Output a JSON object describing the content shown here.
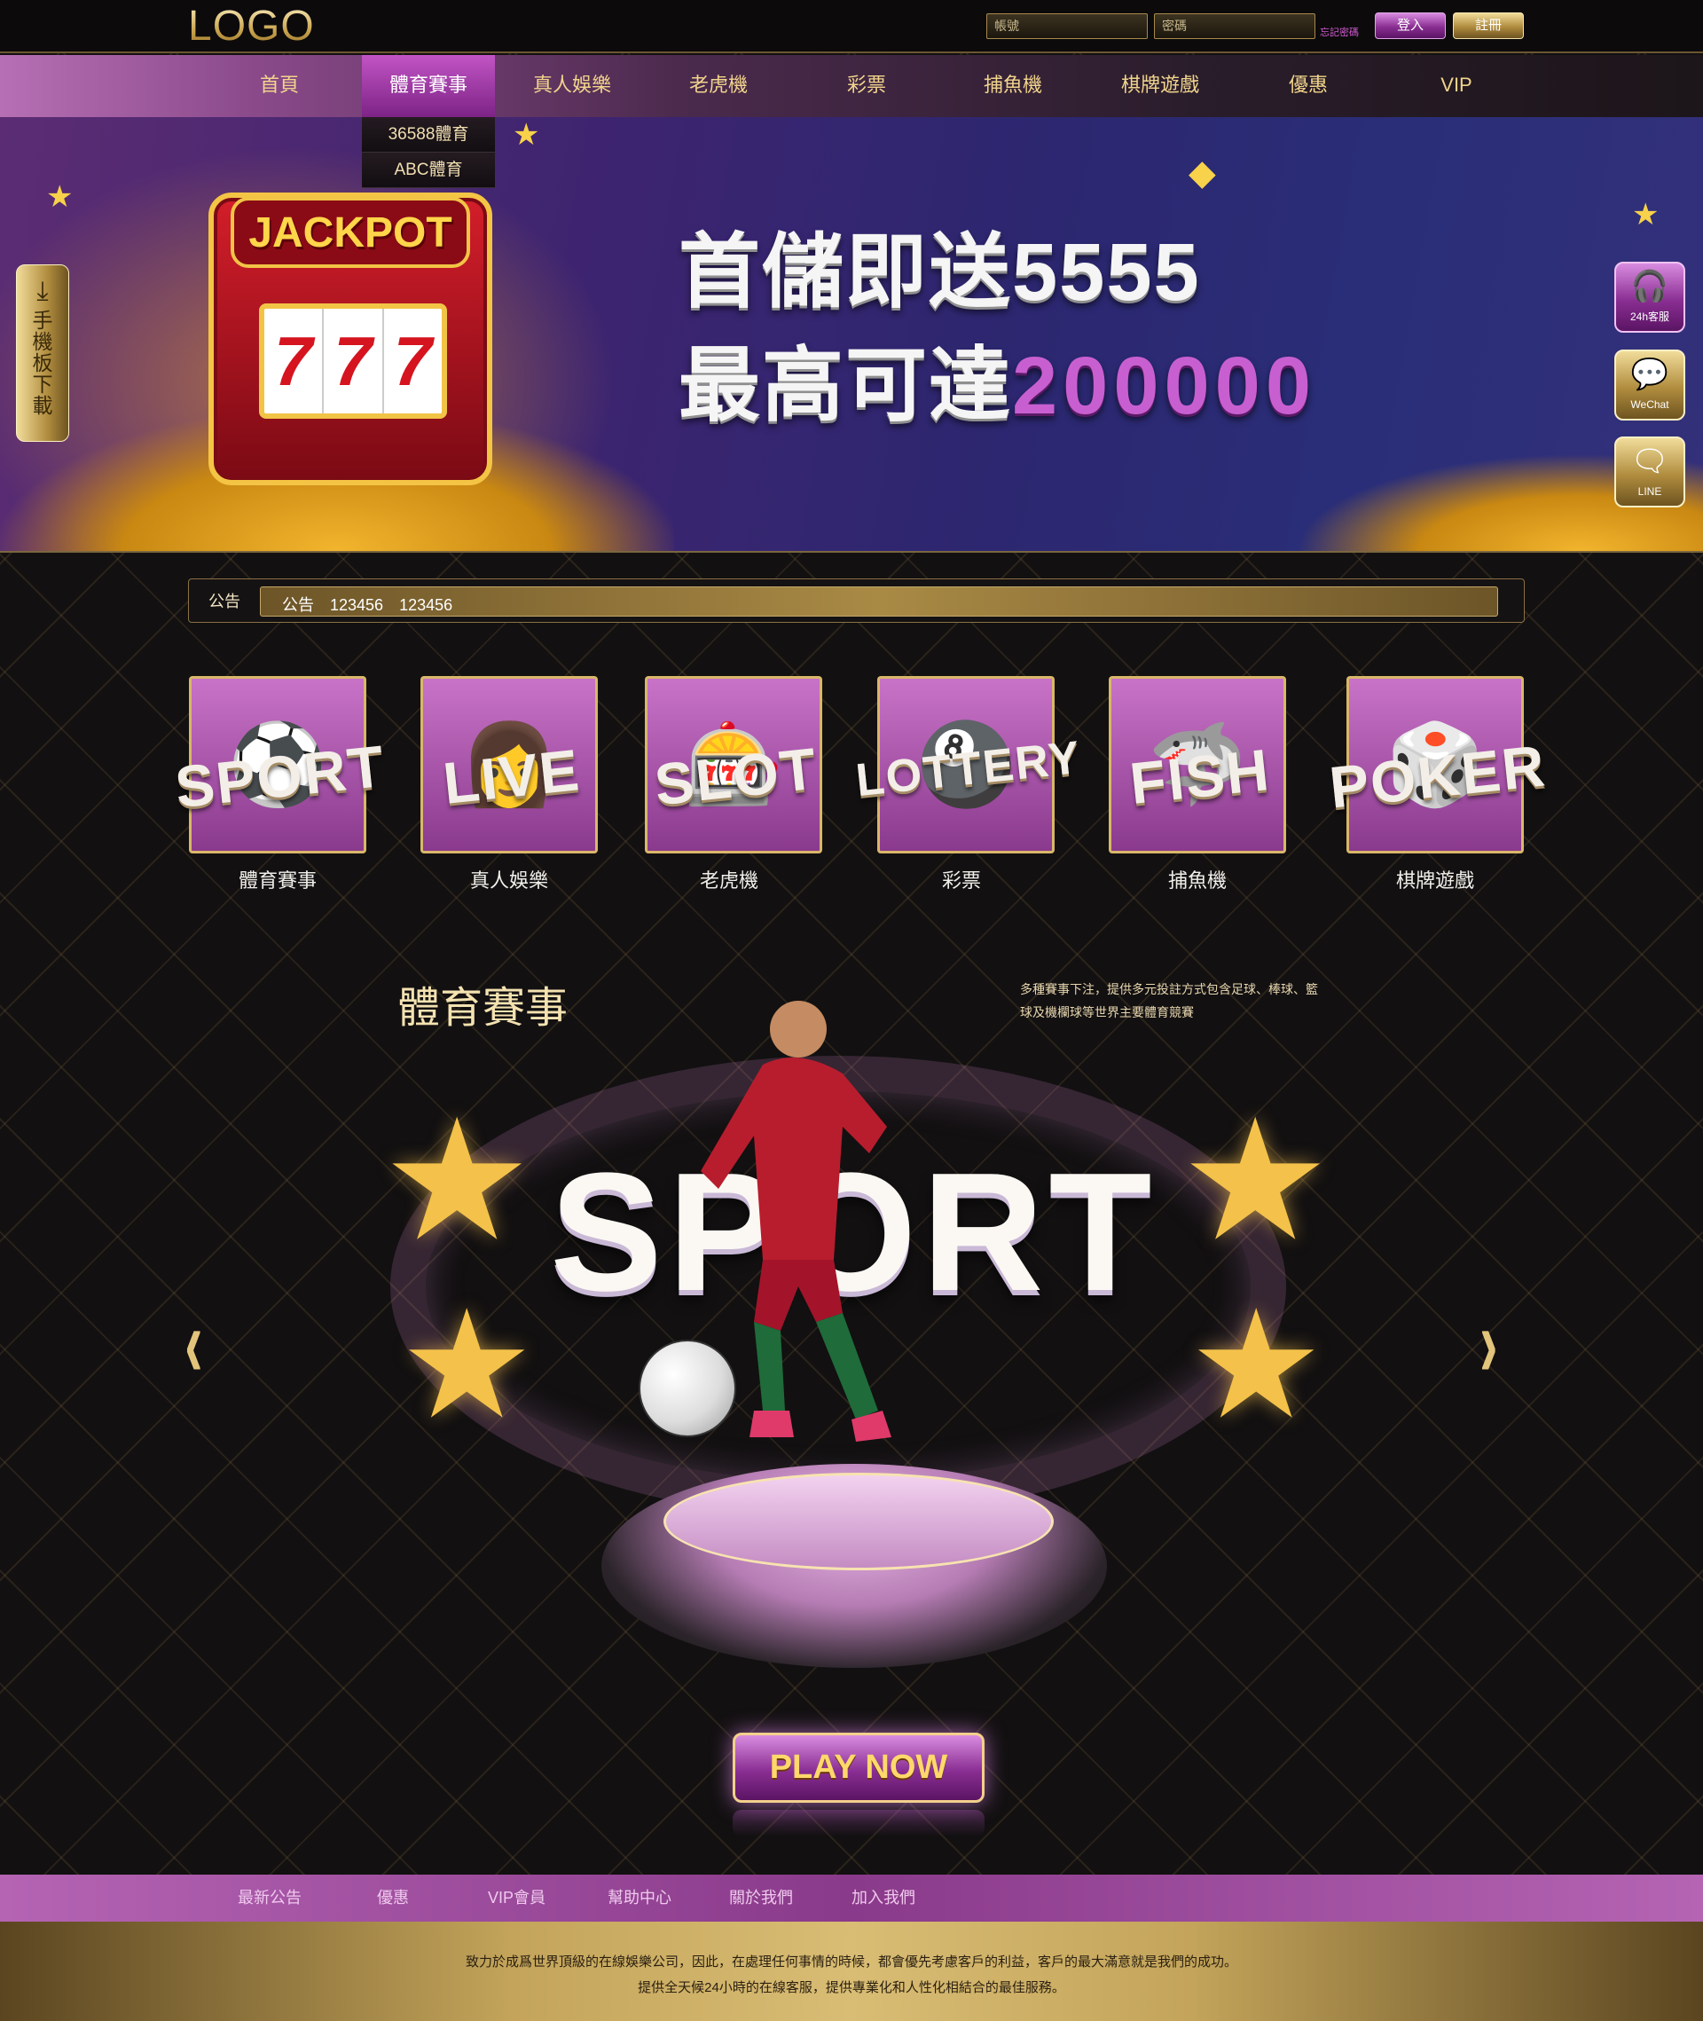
{
  "header": {
    "logo": "LOGO",
    "account_placeholder": "帳號",
    "password_placeholder": "密碼",
    "forgot_password": "忘記密碼",
    "login_label": "登入",
    "register_label": "註冊"
  },
  "nav": {
    "items": [
      "首頁",
      "體育賽事",
      "真人娛樂",
      "老虎機",
      "彩票",
      "捕魚機",
      "棋牌遊戲",
      "優惠",
      "VIP"
    ],
    "active": "體育賽事",
    "dropdown": [
      "36588體育",
      "ABC體育"
    ]
  },
  "banner": {
    "line1": "首儲即送5555",
    "line2_prefix": "最高可達",
    "line2_amount": "200000",
    "slot_header": "JACKPOT",
    "slot_reels": [
      "7",
      "7",
      "7"
    ]
  },
  "side": {
    "app_download_label": "手機板下載",
    "buttons": [
      {
        "label": "24h客服",
        "icon": "support-agent-icon"
      },
      {
        "label": "WeChat",
        "icon": "wechat-icon"
      },
      {
        "label": "LINE",
        "icon": "line-icon"
      }
    ]
  },
  "announcement": {
    "label": "公告",
    "text": "公告　123456　123456"
  },
  "categories": [
    {
      "word": "SPORT",
      "label": "體育賽事",
      "icon": "soccer-player-icon"
    },
    {
      "word": "LIVE",
      "label": "真人娛樂",
      "icon": "live-dealer-icon"
    },
    {
      "word": "SLOT",
      "label": "老虎機",
      "icon": "slot-machine-icon"
    },
    {
      "word": "LOTTERY",
      "label": "彩票",
      "icon": "lottery-balls-icon"
    },
    {
      "word": "FISH",
      "label": "捕魚機",
      "icon": "shark-icon"
    },
    {
      "word": "POKER",
      "label": "棋牌遊戲",
      "icon": "poker-chips-icon"
    }
  ],
  "feature": {
    "title": "體育賽事",
    "description": "多種賽事下注，提供多元投註方式包含足球、棒球、籃球及機欄球等世界主要體育競賽",
    "hero_word": "SPORT",
    "cta": "PLAY NOW"
  },
  "footer": {
    "links": [
      "最新公告",
      "優惠",
      "VIP會員",
      "幫助中心",
      "關於我們",
      "加入我們"
    ],
    "line1": "致力於成爲世界頂級的在線娛樂公司，因此，在處理任何事情的時候，都會優先考慮客戶的利益，客戶的最大滿意就是我們的成功。",
    "line2": "提供全天候24小時的在線客服，提供專業化和人性化相結合的最佳服務。"
  },
  "colors": {
    "gold": "#e2c57b",
    "purple": "#8a2e93",
    "background": "#121011"
  }
}
